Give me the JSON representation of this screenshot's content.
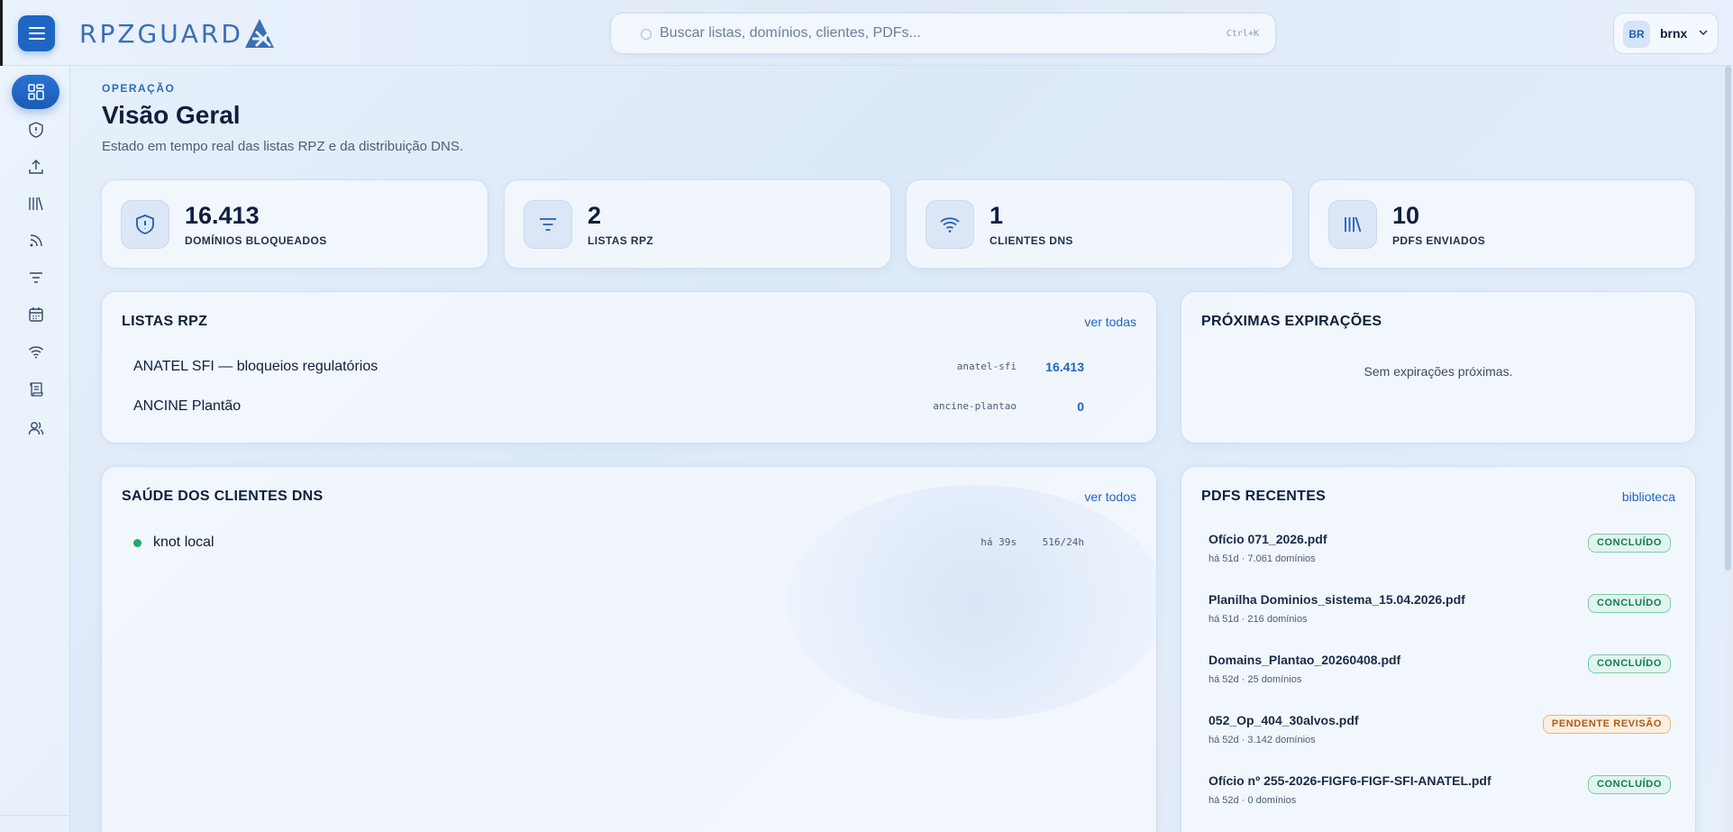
{
  "header": {
    "logo_text": "RPZGUARD",
    "search_placeholder": "Buscar listas, domínios, clientes, PDFs...",
    "search_shortcut": "Ctrl+K",
    "user_initials": "BR",
    "user_name": "brnx"
  },
  "sidebar": {
    "items": [
      {
        "icon": "dashboard-icon",
        "active": true
      },
      {
        "icon": "shield-icon"
      },
      {
        "icon": "upload-icon"
      },
      {
        "icon": "library-icon"
      },
      {
        "icon": "rss-icon"
      },
      {
        "icon": "filter-icon"
      },
      {
        "icon": "calendar-icon"
      },
      {
        "icon": "wifi-icon"
      },
      {
        "icon": "scroll-icon"
      },
      {
        "icon": "users-icon"
      }
    ]
  },
  "page": {
    "eyebrow": "OPERAÇÃO",
    "title": "Visão Geral",
    "subtitle": "Estado em tempo real das listas RPZ e da distribuição DNS."
  },
  "stats": [
    {
      "icon": "shield-icon",
      "value": "16.413",
      "label": "DOMÍNIOS BLOQUEADOS"
    },
    {
      "icon": "filter-icon",
      "value": "2",
      "label": "LISTAS RPZ"
    },
    {
      "icon": "wifi-icon",
      "value": "1",
      "label": "CLIENTES DNS"
    },
    {
      "icon": "library-icon",
      "value": "10",
      "label": "PDFS ENVIADOS"
    }
  ],
  "rpz_lists": {
    "title": "LISTAS RPZ",
    "link": "ver todas",
    "rows": [
      {
        "name": "ANATEL SFI — bloqueios regulatórios",
        "slug": "anatel-sfi",
        "count": "16.413"
      },
      {
        "name": "ANCINE Plantão",
        "slug": "ancine-plantao",
        "count": "0"
      }
    ]
  },
  "expirations": {
    "title": "PRÓXIMAS EXPIRAÇÕES",
    "empty": "Sem expirações próximas."
  },
  "dns_health": {
    "title": "SAÚDE DOS CLIENTES DNS",
    "link": "ver todos",
    "rows": [
      {
        "name": "knot local",
        "ago": "há 39s",
        "rate": "516/24h",
        "status_color": "#1ea86e"
      }
    ]
  },
  "recent_pdfs": {
    "title": "PDFS RECENTES",
    "link": "biblioteca",
    "rows": [
      {
        "name": "Ofício 071_2026.pdf",
        "meta": "há 51d · 7.061 domínios",
        "status": "CONCLUÍDO",
        "kind": "ok"
      },
      {
        "name": "Planilha Dominios_sistema_15.04.2026.pdf",
        "meta": "há 51d · 216 domínios",
        "status": "CONCLUÍDO",
        "kind": "ok"
      },
      {
        "name": "Domains_Plantao_20260408.pdf",
        "meta": "há 52d · 25 domínios",
        "status": "CONCLUÍDO",
        "kind": "ok"
      },
      {
        "name": "052_Op_404_30alvos.pdf",
        "meta": "há 52d · 3.142 domínios",
        "status": "PENDENTE REVISÃO",
        "kind": "warn"
      },
      {
        "name": "Ofício nº 255-2026-FIGF6-FIGF-SFI-ANATEL.pdf",
        "meta": "há 52d · 0 domínios",
        "status": "CONCLUÍDO",
        "kind": "ok"
      }
    ]
  },
  "colors": {
    "accent": "#1f66c4",
    "ok": "#137a57",
    "warn": "#b05a14"
  }
}
